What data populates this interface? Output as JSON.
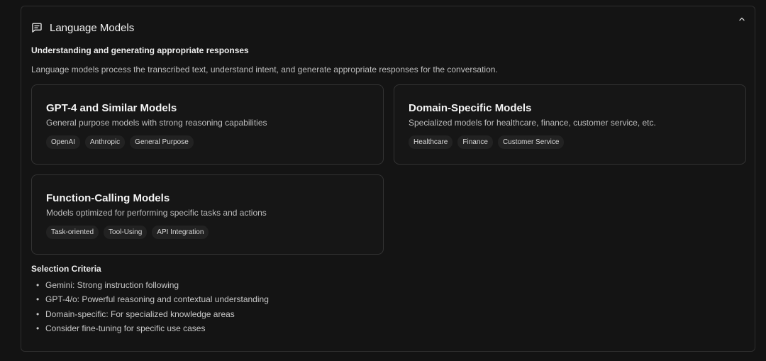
{
  "section": {
    "title": "Language Models",
    "icon": "message-square-icon",
    "collapse_icon": "chevron-up-icon",
    "subtitle": "Understanding and generating appropriate responses",
    "description": "Language models process the transcribed text, understand intent, and generate appropriate responses for the conversation."
  },
  "cards": [
    {
      "name": "GPT-4 and Similar Models",
      "description": "General purpose models with strong reasoning capabilities",
      "tags": [
        "OpenAI",
        "Anthropic",
        "General Purpose"
      ]
    },
    {
      "name": "Domain-Specific Models",
      "description": "Specialized models for healthcare, finance, customer service, etc.",
      "tags": [
        "Healthcare",
        "Finance",
        "Customer Service"
      ]
    },
    {
      "name": "Function-Calling Models",
      "description": "Models optimized for performing specific tasks and actions",
      "tags": [
        "Task-oriented",
        "Tool-Using",
        "API Integration"
      ]
    }
  ],
  "criteria": {
    "title": "Selection Criteria",
    "items": [
      "Gemini: Strong instruction following",
      "GPT-4/o: Powerful reasoning and contextual understanding",
      "Domain-specific: For specialized knowledge areas",
      "Consider fine-tuning for specific use cases"
    ]
  },
  "colors": {
    "background": "#131313",
    "border": "#2e2e2e",
    "tag_bg": "#222222"
  }
}
